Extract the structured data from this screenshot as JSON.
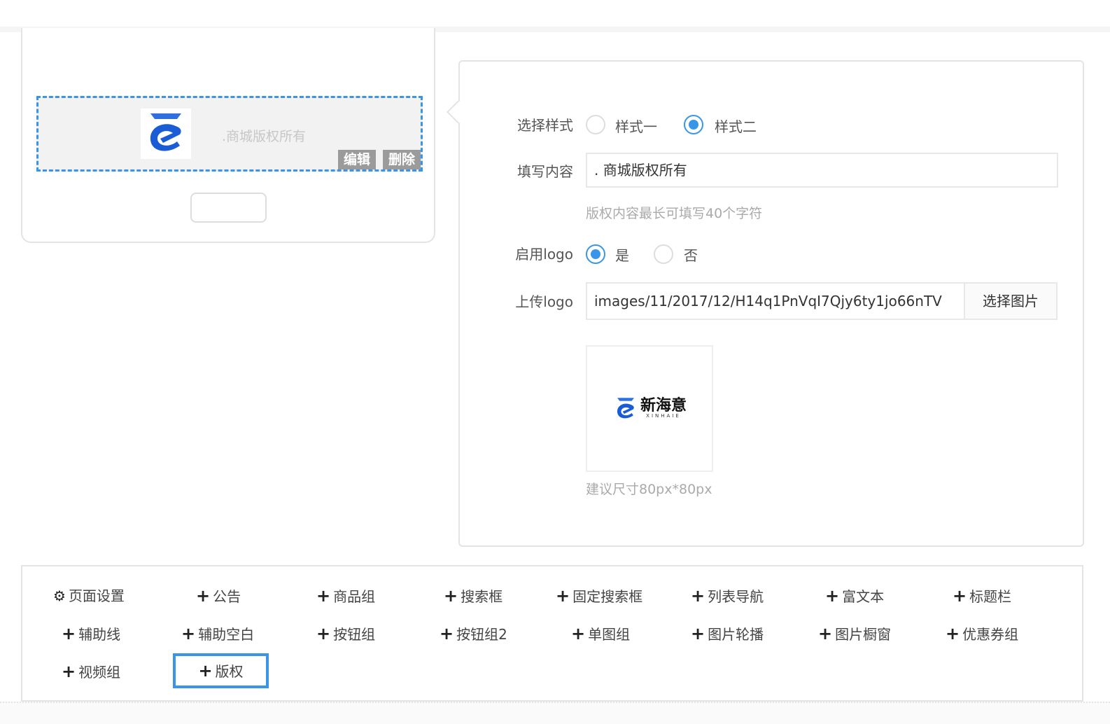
{
  "preview": {
    "copyright_text": ".商城版权所有",
    "edit_label": "编辑",
    "delete_label": "删除"
  },
  "settings": {
    "style_label": "选择样式",
    "style_options": [
      "样式一",
      "样式二"
    ],
    "style_selected": 1,
    "content_label": "填写内容",
    "content_value": ".     商城版权所有",
    "content_help": "版权内容最长可填写40个字符",
    "logo_enable_label": "启用logo",
    "logo_enable_options": [
      "是",
      "否"
    ],
    "logo_enable_selected": 0,
    "upload_label": "上传logo",
    "upload_value": "images/11/2017/12/H14q1PnVqI7Qjy6ty1jo66nTV",
    "choose_image_label": "选择图片",
    "logo_brand_text": "新海意",
    "logo_brand_sub": "XINHAIE",
    "size_hint": "建议尺寸80px*80px"
  },
  "components": [
    {
      "label": "页面设置",
      "icon": "gear-icon"
    },
    {
      "label": "公告",
      "icon": "plus-icon"
    },
    {
      "label": "商品组",
      "icon": "plus-icon"
    },
    {
      "label": "搜索框",
      "icon": "plus-icon"
    },
    {
      "label": "固定搜索框",
      "icon": "plus-icon"
    },
    {
      "label": "列表导航",
      "icon": "plus-icon"
    },
    {
      "label": "富文本",
      "icon": "plus-icon"
    },
    {
      "label": "标题栏",
      "icon": "plus-icon"
    },
    {
      "label": "辅助线",
      "icon": "plus-icon"
    },
    {
      "label": "辅助空白",
      "icon": "plus-icon"
    },
    {
      "label": "按钮组",
      "icon": "plus-icon"
    },
    {
      "label": "按钮组2",
      "icon": "plus-icon"
    },
    {
      "label": "单图组",
      "icon": "plus-icon"
    },
    {
      "label": "图片轮播",
      "icon": "plus-icon"
    },
    {
      "label": "图片橱窗",
      "icon": "plus-icon"
    },
    {
      "label": "优惠券组",
      "icon": "plus-icon"
    },
    {
      "label": "视频组",
      "icon": "plus-icon"
    },
    {
      "label": "版权",
      "icon": "plus-icon"
    }
  ],
  "active_component": 17,
  "colors": {
    "accent": "#3a95e8",
    "logo_blue": "#1a5bd6"
  }
}
